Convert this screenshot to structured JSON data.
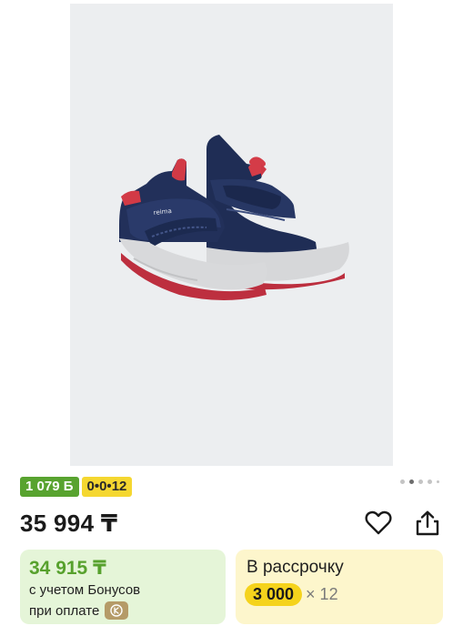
{
  "product": {
    "image_alt": "Детские ботинки Reima",
    "brand_print": "reima"
  },
  "gallery": {
    "dots": 5,
    "active_index": 1
  },
  "badges": {
    "bonus": "1 079 Б",
    "installment": "0•0•12"
  },
  "price": {
    "current": "35 994 ₸"
  },
  "actions": {
    "favorite_icon": "heart-icon",
    "share_icon": "share-icon"
  },
  "bonus_card": {
    "price": "34 915 ₸",
    "line1": "с учетом Бонусов",
    "line2": "при оплате",
    "pay_icon": "kaspi-pay-icon"
  },
  "installment_card": {
    "title": "В рассрочку",
    "amount": "3 000",
    "months": "× 12"
  },
  "colors": {
    "bonus_green": "#58a32f",
    "installment_yellow": "#f5d730",
    "shoe_navy": "#22305a",
    "shoe_red": "#d23a46"
  }
}
